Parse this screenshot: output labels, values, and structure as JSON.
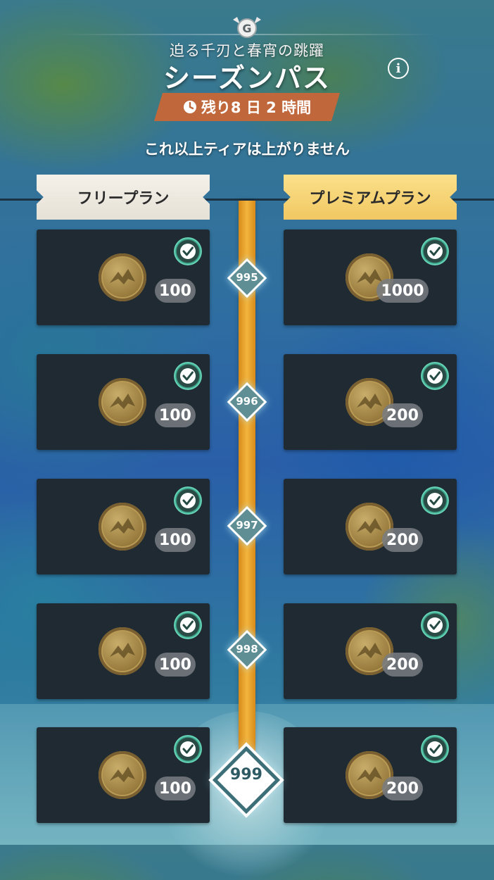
{
  "header": {
    "subtitle": "迫る千刃と春宵の跳躍",
    "title": "シーズンパス",
    "info_icon": "info-icon",
    "timer_icon": "clock-icon",
    "timer_text": "残り8 日 2 時間"
  },
  "notice": "これ以上ティアは上がりません",
  "plans": {
    "free_label": "フリープラン",
    "premium_label": "プレミアムプラン"
  },
  "colors": {
    "track": "#f2b53e",
    "card": "#1f2a33",
    "timer_bg": "#c0683c",
    "premium_tab": "#f1c862",
    "free_tab": "#ece8df",
    "claimed_check": "#6fe0c0"
  },
  "tiers": [
    {
      "tier": "995",
      "free": {
        "amount": "100",
        "claimed": true
      },
      "premium": {
        "amount": "1000",
        "claimed": true
      }
    },
    {
      "tier": "996",
      "free": {
        "amount": "100",
        "claimed": true
      },
      "premium": {
        "amount": "200",
        "claimed": true
      }
    },
    {
      "tier": "997",
      "free": {
        "amount": "100",
        "claimed": true
      },
      "premium": {
        "amount": "200",
        "claimed": true
      }
    },
    {
      "tier": "998",
      "free": {
        "amount": "100",
        "claimed": true
      },
      "premium": {
        "amount": "200",
        "claimed": true
      }
    },
    {
      "tier": "999",
      "free": {
        "amount": "100",
        "claimed": true
      },
      "premium": {
        "amount": "200",
        "claimed": true
      }
    }
  ],
  "reward_icon": "gold-coin-icon",
  "claimed_icon": "check-icon"
}
